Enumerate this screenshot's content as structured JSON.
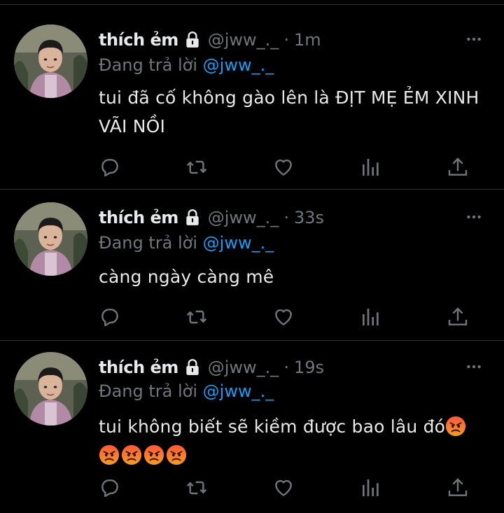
{
  "tweets": [
    {
      "display_name": "thích ẻm",
      "handle": "@jww_._",
      "separator": "·",
      "time": "1m",
      "reply_prefix": "Đang trả lời",
      "reply_to": "@jww_._",
      "text_line1": "tui đã cố không gào lên là ĐỊT MẸ ẺM XINH",
      "text_line2": "VÃI NỒI"
    },
    {
      "display_name": "thích ẻm",
      "handle": "@jww_._",
      "separator": "·",
      "time": "33s",
      "reply_prefix": "Đang trả lời",
      "reply_to": "@jww_._",
      "text_line1": "càng ngày càng mê"
    },
    {
      "display_name": "thích ẻm",
      "handle": "@jww_._",
      "separator": "·",
      "time": "19s",
      "reply_prefix": "Đang trả lời",
      "reply_to": "@jww_._",
      "text_line1": "tui không biết sẽ kiềm được bao lâu đó",
      "emoji": "angry-face",
      "emoji_count_line1": 1,
      "emoji_count_line2": 4
    }
  ],
  "icons": {
    "lock": "lock-icon",
    "more": "more-icon",
    "reply": "reply-icon",
    "retweet": "retweet-icon",
    "like": "like-icon",
    "views": "views-icon",
    "share": "share-icon"
  },
  "colors": {
    "background": "#000000",
    "text": "#e7e9ea",
    "muted": "#71767b",
    "accent": "#1d9bf0",
    "divider": "#2f3336"
  }
}
